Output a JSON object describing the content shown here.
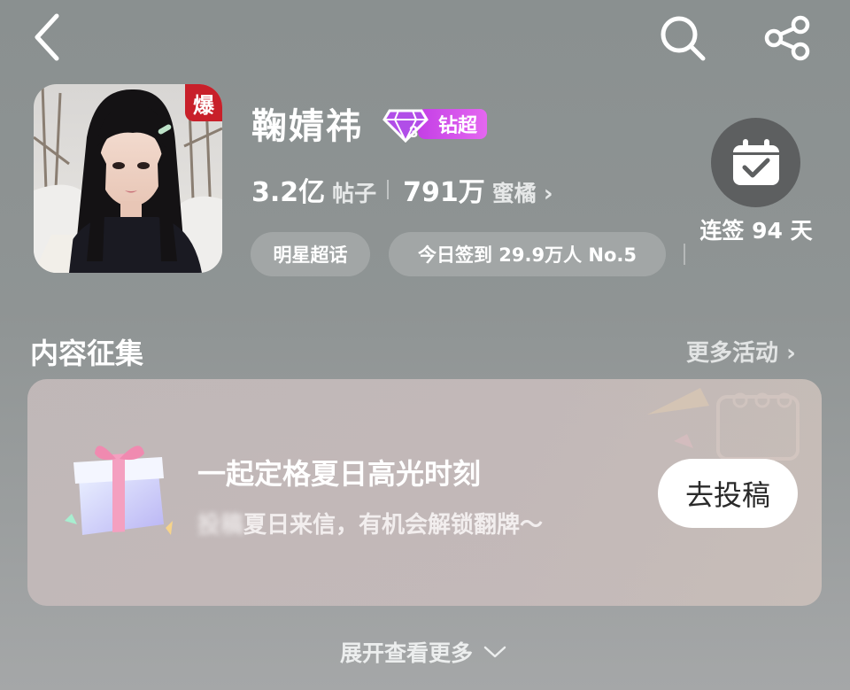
{
  "topbar": {
    "back_icon": "back-chevron-icon",
    "search_icon": "search-icon",
    "share_icon": "share-icon"
  },
  "profile": {
    "avatar_badge": "爆",
    "name": "鞠婧祎",
    "level_badge": "钻超",
    "level_number": "3",
    "posts_count": "3.2亿",
    "posts_label": "帖子",
    "fans_count": "791万",
    "fans_label": "蜜橘",
    "chips": [
      "明星超话",
      "今日签到 29.9万人 No.5"
    ]
  },
  "checkin": {
    "label": "连签 94 天",
    "icon": "calendar-check-icon"
  },
  "section": {
    "title": "内容征集",
    "more_label": "更多活动"
  },
  "card": {
    "title": "一起定格夏日高光时刻",
    "subtitle_blurred": "投稿",
    "subtitle": "夏日来信，有机会解锁翻牌～",
    "button": "去投稿",
    "icon": "gift-box-icon"
  },
  "footer": {
    "expand_label": "展开查看更多"
  },
  "colors": {
    "badge_red": "#c8202a",
    "level_purple": "#c43fe6",
    "checkin_circle": "#5d5f60"
  }
}
